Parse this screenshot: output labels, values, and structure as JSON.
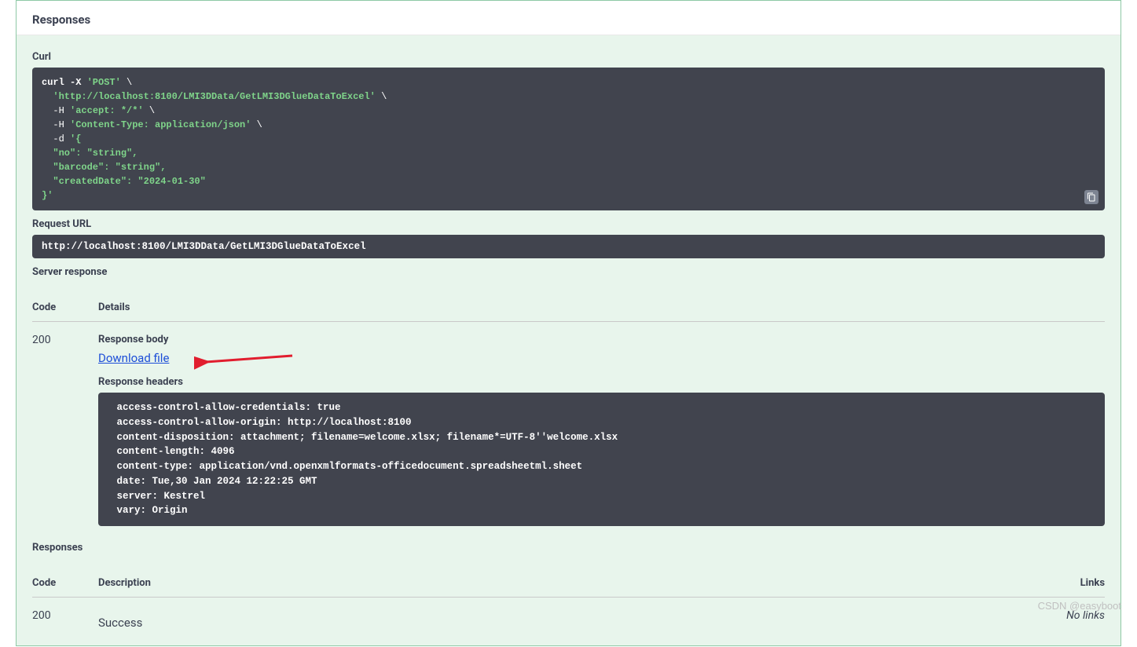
{
  "header": {
    "title": "Responses"
  },
  "curl": {
    "label": "Curl",
    "parts": {
      "cmd": "curl -X ",
      "method": "'POST'",
      "slash": " \\",
      "url": "'http://localhost:8100/LMI3DData/GetLMI3DGlueDataToExcel'",
      "h1_pre": "  -H ",
      "h1": "'accept: */*'",
      "h2_pre": "  -H ",
      "h2": "'Content-Type: application/json'",
      "d_pre": "  -d ",
      "d_open": "'{",
      "b1": "  \"no\": \"string\",",
      "b2": "  \"barcode\": \"string\",",
      "b3": "  \"createdDate\": \"2024-01-30\"",
      "d_close": "}'"
    }
  },
  "request_url": {
    "label": "Request URL",
    "value": "http://localhost:8100/LMI3DData/GetLMI3DGlueDataToExcel"
  },
  "server_response": {
    "label": "Server response",
    "columns": {
      "code": "Code",
      "details": "Details"
    },
    "row": {
      "code": "200",
      "body_label": "Response body",
      "download_text": "Download file",
      "headers_label": "Response headers",
      "headers_text": " access-control-allow-credentials: true \n access-control-allow-origin: http://localhost:8100 \n content-disposition: attachment; filename=welcome.xlsx; filename*=UTF-8''welcome.xlsx \n content-length: 4096 \n content-type: application/vnd.openxmlformats-officedocument.spreadsheetml.sheet \n date: Tue,30 Jan 2024 12:22:25 GMT \n server: Kestrel \n vary: Origin "
    }
  },
  "responses_list": {
    "label": "Responses",
    "columns": {
      "code": "Code",
      "description": "Description",
      "links": "Links"
    },
    "row": {
      "code": "200",
      "description": "Success",
      "links": "No links"
    }
  },
  "watermark": "CSDN @easyboot"
}
